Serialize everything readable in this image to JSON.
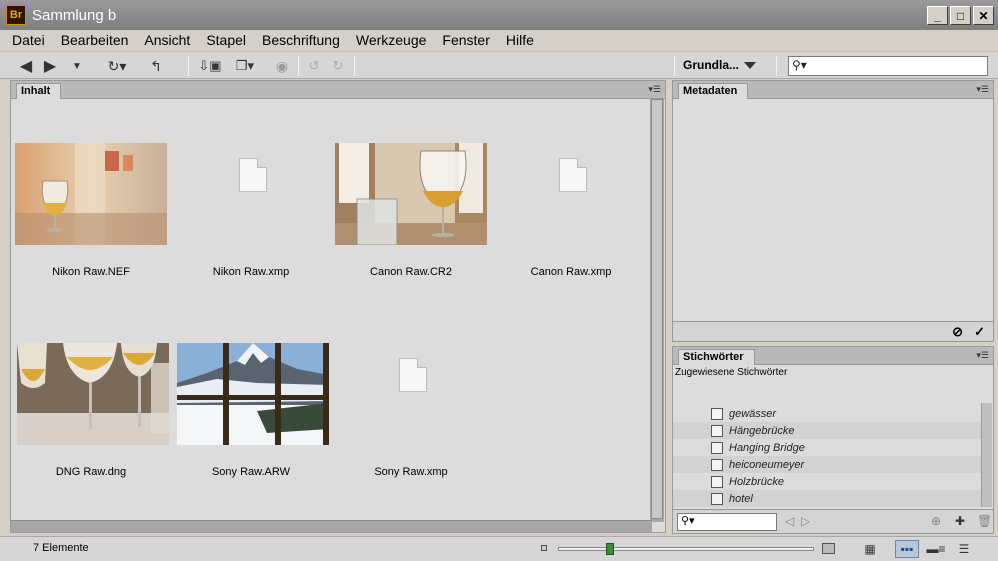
{
  "window": {
    "title": "Sammlung b",
    "app_icon_label": "Br"
  },
  "menu": [
    "Datei",
    "Bearbeiten",
    "Ansicht",
    "Stapel",
    "Beschriftung",
    "Werkzeuge",
    "Fenster",
    "Hilfe"
  ],
  "toolbar": {
    "workspace": "Grundla...",
    "search_value": ""
  },
  "content": {
    "tab": "Inhalt",
    "items": [
      {
        "name": "Nikon Raw.NEF",
        "kind": "image"
      },
      {
        "name": "Nikon Raw.xmp",
        "kind": "file"
      },
      {
        "name": "Canon Raw.CR2",
        "kind": "image"
      },
      {
        "name": "Canon Raw.xmp",
        "kind": "file"
      },
      {
        "name": "DNG Raw.dng",
        "kind": "image"
      },
      {
        "name": "Sony Raw.ARW",
        "kind": "image"
      },
      {
        "name": "Sony Raw.xmp",
        "kind": "file"
      }
    ]
  },
  "metadata": {
    "tab": "Metadaten"
  },
  "keywords": {
    "tab": "Stichwörter",
    "subtitle": "Zugewiesene Stichwörter",
    "items": [
      "gewässer",
      "Hängebrücke",
      "Hanging Bridge",
      "heiconeumeyer",
      "Holzbrücke",
      "hotel"
    ],
    "search_value": ""
  },
  "status": {
    "count_text": "7 Elemente",
    "thumbnail_size": 0.19
  },
  "colors": {
    "panel_bg": "#dcdcdc",
    "active_view": "#b8c8da"
  }
}
